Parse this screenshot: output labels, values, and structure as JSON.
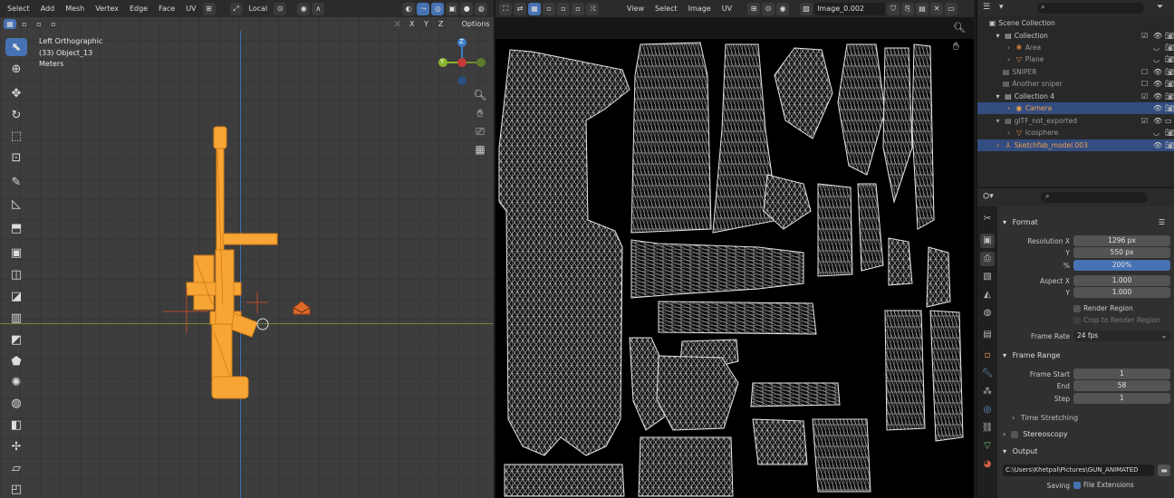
{
  "viewport": {
    "menus": [
      "Select",
      "Add",
      "Mesh",
      "Vertex",
      "Edge",
      "Face",
      "UV"
    ],
    "transform_orientation": "Local",
    "axis_buttons": [
      "X",
      "Y",
      "Z"
    ],
    "options_label": "Options",
    "overlay_lines": [
      "Left Orthographic",
      "(33) Object_13",
      "Meters"
    ],
    "gizmo_labels": {
      "z": "Z",
      "y": "Y"
    },
    "colors": {
      "model": "#f7a636",
      "x_axis": "#c73a3a",
      "y_axis": "#8ab72c",
      "z_axis": "#3d7cc9",
      "selected": "#4772b3"
    }
  },
  "uv_editor": {
    "menus": [
      "View",
      "Select",
      "Image",
      "UV"
    ],
    "image_name": "Image_0.002"
  },
  "outliner": {
    "search_placeholder": "",
    "rows": [
      {
        "label": "Scene Collection",
        "icon": "scene-collection-icon"
      },
      {
        "label": "Collection",
        "icon": "collection-icon"
      },
      {
        "label": "Area",
        "icon": "light-icon"
      },
      {
        "label": "Plane",
        "icon": "mesh-icon"
      },
      {
        "label": "SNIPER",
        "icon": "collection-icon"
      },
      {
        "label": "Another sniper",
        "icon": "collection-icon"
      },
      {
        "label": "Collection 4",
        "icon": "collection-icon"
      },
      {
        "label": "Camera",
        "icon": "camera-icon"
      },
      {
        "label": "glTF_not_exported",
        "icon": "collection-icon"
      },
      {
        "label": "Icosphere",
        "icon": "mesh-icon"
      },
      {
        "label": "Sketchfab_model.003",
        "icon": "armature-icon"
      }
    ]
  },
  "properties": {
    "format": {
      "title": "Format",
      "resolution_x_label": "Resolution X",
      "resolution_x": "1296 px",
      "resolution_y_label": "Y",
      "resolution_y": "550 px",
      "percent_label": "%",
      "percent": "200%",
      "aspect_x_label": "Aspect X",
      "aspect_x": "1.000",
      "aspect_y_label": "Y",
      "aspect_y": "1.000",
      "render_region": "Render Region",
      "crop": "Crop to Render Region",
      "frame_rate_label": "Frame Rate",
      "frame_rate": "24 fps"
    },
    "frame_range": {
      "title": "Frame Range",
      "start_label": "Frame Start",
      "start": "1",
      "end_label": "End",
      "end": "58",
      "step_label": "Step",
      "step": "1"
    },
    "time_stretching": "Time Stretching",
    "stereoscopy": "Stereoscopy",
    "output": {
      "title": "Output",
      "path": "C:\\Users\\Khetpal\\Pictures\\GUN_ANIMATED",
      "saving_label": "Saving",
      "file_extensions": "File Extensions"
    }
  }
}
